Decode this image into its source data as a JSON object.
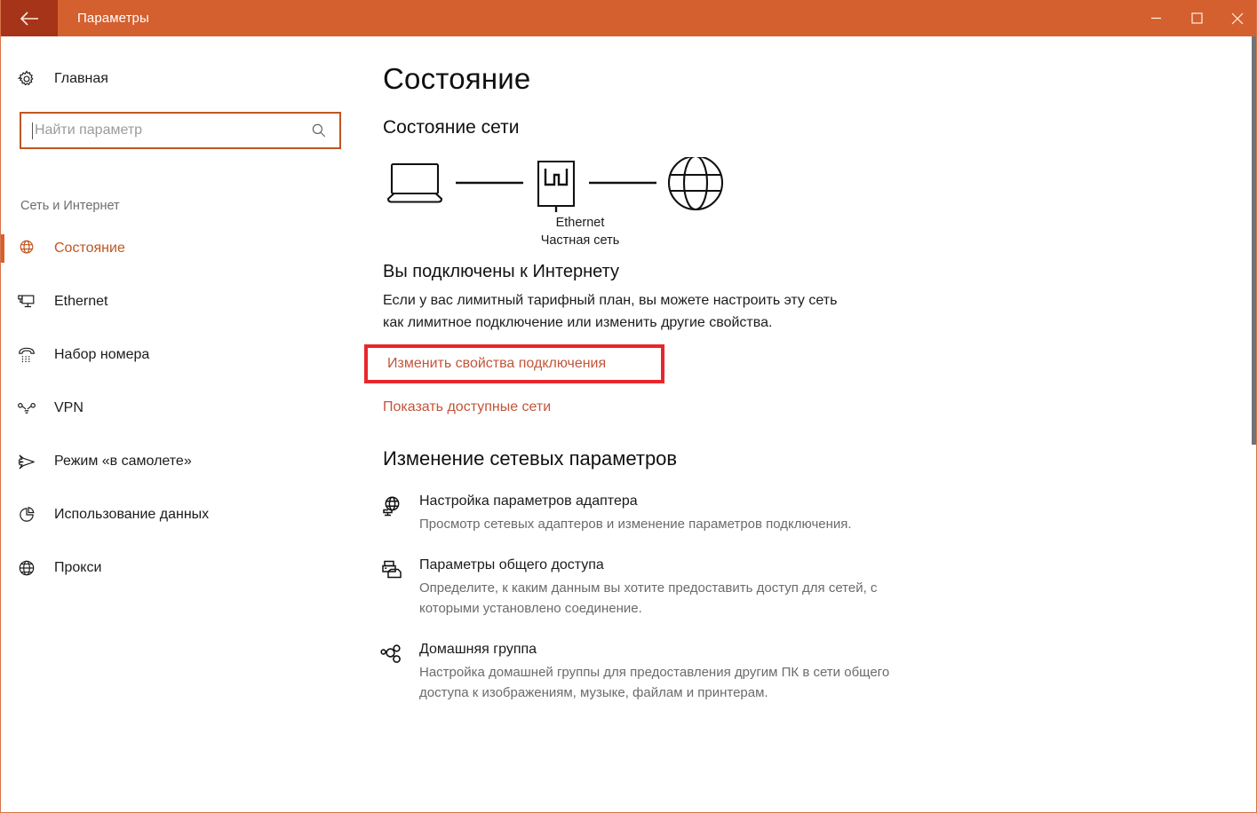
{
  "colors": {
    "titlebar": "#d4602f",
    "back_button": "#a63419",
    "accent": "#c05621",
    "highlight_border": "#e8262c",
    "link": "#c2553a"
  },
  "titlebar": {
    "back_icon": "back-arrow-icon",
    "title": "Параметры",
    "minimize_label": "minimize-icon",
    "maximize_label": "maximize-icon",
    "close_label": "close-icon"
  },
  "sidebar": {
    "home": {
      "icon": "gear-icon",
      "label": "Главная"
    },
    "search": {
      "value": "",
      "placeholder": "Найти параметр",
      "icon": "search-icon"
    },
    "group_label": "Сеть и Интернет",
    "items": [
      {
        "icon": "globe-status-icon",
        "label": "Состояние",
        "selected": true
      },
      {
        "icon": "ethernet-icon",
        "label": "Ethernet",
        "selected": false
      },
      {
        "icon": "dialup-phone-icon",
        "label": "Набор номера",
        "selected": false
      },
      {
        "icon": "vpn-icon",
        "label": "VPN",
        "selected": false
      },
      {
        "icon": "airplane-icon",
        "label": "Режим «в самолете»",
        "selected": false
      },
      {
        "icon": "data-usage-icon",
        "label": "Использование данных",
        "selected": false
      },
      {
        "icon": "proxy-globe-icon",
        "label": "Прокси",
        "selected": false
      }
    ]
  },
  "main": {
    "page_title": "Состояние",
    "section_title": "Состояние сети",
    "diagram": {
      "device_icon": "laptop-icon",
      "adapter_icon": "ethernet-port-icon",
      "internet_icon": "globe-icon",
      "adapter_name": "Ethernet",
      "adapter_subtitle": "Частная сеть"
    },
    "status_heading": "Вы подключены к Интернету",
    "status_description": "Если у вас лимитный тарифный план, вы можете настроить эту сеть как лимитное подключение или изменить другие свойства.",
    "link_change_properties": "Изменить свойства подключения",
    "link_show_networks": "Показать доступные сети",
    "change_settings_heading": "Изменение сетевых параметров",
    "settings": [
      {
        "icon": "adapter-globe-icon",
        "title": "Настройка параметров адаптера",
        "description": "Просмотр сетевых адаптеров и изменение параметров подключения."
      },
      {
        "icon": "sharing-printer-folder-icon",
        "title": "Параметры общего доступа",
        "description": "Определите, к каким данным вы хотите предоставить доступ для сетей, с которыми установлено соединение."
      },
      {
        "icon": "homegroup-icon",
        "title": "Домашняя группа",
        "description": "Настройка домашней группы для предоставления другим ПК в сети общего доступа к изображениям, музыке, файлам и принтерам."
      }
    ]
  }
}
